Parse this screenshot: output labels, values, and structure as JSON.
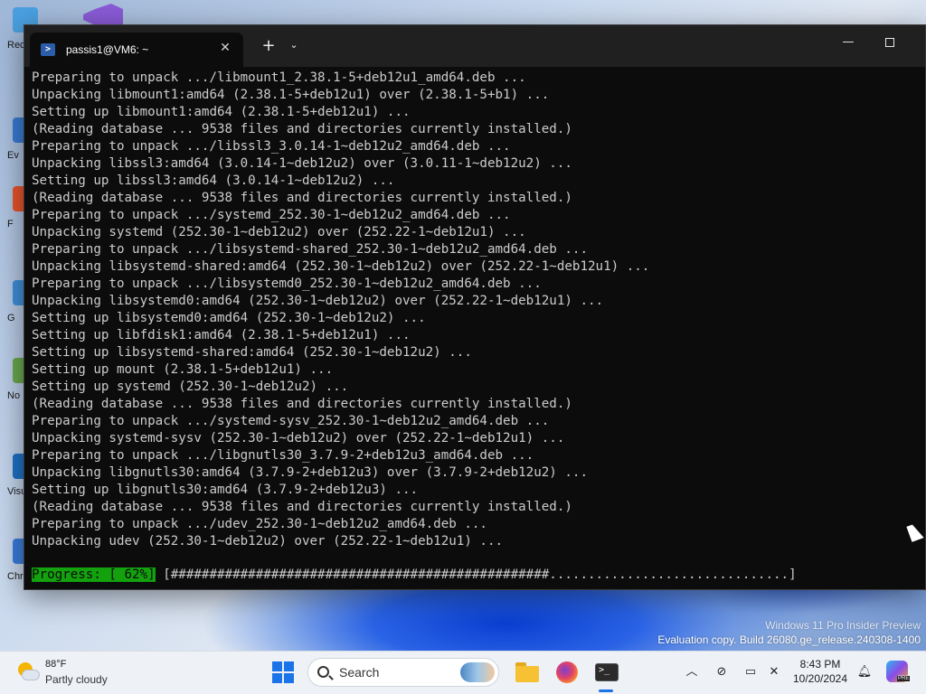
{
  "desktop": {
    "icons": [
      {
        "label": "Rec",
        "color": "#4aa0e0"
      },
      {
        "label": "Ev",
        "color": "#3a7bd5"
      },
      {
        "label": "F",
        "color": "#e8542c"
      },
      {
        "label": "G",
        "color": "#3f8fd9"
      },
      {
        "label": "No",
        "color": "#6aa84f"
      },
      {
        "label": "Visu",
        "color": "#1e72c6"
      },
      {
        "label": "Chromium",
        "color": "#3b7ddd"
      }
    ]
  },
  "terminal": {
    "tab_title": "passis1@VM6: ~",
    "tab_icon": "powershell-icon",
    "new_tab_label": "+",
    "dropdown_label": "⌄",
    "close_label": "✕",
    "minimize_label": "—",
    "lines": [
      "Preparing to unpack .../libmount1_2.38.1-5+deb12u1_amd64.deb ...",
      "Unpacking libmount1:amd64 (2.38.1-5+deb12u1) over (2.38.1-5+b1) ...",
      "Setting up libmount1:amd64 (2.38.1-5+deb12u1) ...",
      "(Reading database ... 9538 files and directories currently installed.)",
      "Preparing to unpack .../libssl3_3.0.14-1~deb12u2_amd64.deb ...",
      "Unpacking libssl3:amd64 (3.0.14-1~deb12u2) over (3.0.11-1~deb12u2) ...",
      "Setting up libssl3:amd64 (3.0.14-1~deb12u2) ...",
      "(Reading database ... 9538 files and directories currently installed.)",
      "Preparing to unpack .../systemd_252.30-1~deb12u2_amd64.deb ...",
      "Unpacking systemd (252.30-1~deb12u2) over (252.22-1~deb12u1) ...",
      "Preparing to unpack .../libsystemd-shared_252.30-1~deb12u2_amd64.deb ...",
      "Unpacking libsystemd-shared:amd64 (252.30-1~deb12u2) over (252.22-1~deb12u1) ...",
      "Preparing to unpack .../libsystemd0_252.30-1~deb12u2_amd64.deb ...",
      "Unpacking libsystemd0:amd64 (252.30-1~deb12u2) over (252.22-1~deb12u1) ...",
      "Setting up libsystemd0:amd64 (252.30-1~deb12u2) ...",
      "Setting up libfdisk1:amd64 (2.38.1-5+deb12u1) ...",
      "Setting up libsystemd-shared:amd64 (252.30-1~deb12u2) ...",
      "Setting up mount (2.38.1-5+deb12u1) ...",
      "Setting up systemd (252.30-1~deb12u2) ...",
      "(Reading database ... 9538 files and directories currently installed.)",
      "Preparing to unpack .../systemd-sysv_252.30-1~deb12u2_amd64.deb ...",
      "Unpacking systemd-sysv (252.30-1~deb12u2) over (252.22-1~deb12u1) ...",
      "Preparing to unpack .../libgnutls30_3.7.9-2+deb12u3_amd64.deb ...",
      "Unpacking libgnutls30:amd64 (3.7.9-2+deb12u3) over (3.7.9-2+deb12u2) ...",
      "Setting up libgnutls30:amd64 (3.7.9-2+deb12u3) ...",
      "(Reading database ... 9538 files and directories currently installed.)",
      "Preparing to unpack .../udev_252.30-1~deb12u2_amd64.deb ...",
      "Unpacking udev (252.30-1~deb12u2) over (252.22-1~deb12u1) ..."
    ],
    "progress_label": "Progress: [ 62%]",
    "progress_bar": " [#################################################...............................]",
    "progress_fraction": 0.62,
    "colors": {
      "background": "#0c0c0c",
      "text": "#cccccc",
      "progress_highlight": "#13a10e"
    }
  },
  "watermark": {
    "line1": "Windows 11 Pro Insider Preview",
    "line2": "Evaluation copy. Build 26080.ge_release.240308-1400"
  },
  "taskbar": {
    "weather_temp": "88°F",
    "weather_desc": "Partly cloudy",
    "search_label": "Search",
    "time": "8:43 PM",
    "date": "10/20/2024",
    "tray_chevron": "︿",
    "copilot_badge": "PRE",
    "accent": "#1a73e8"
  }
}
